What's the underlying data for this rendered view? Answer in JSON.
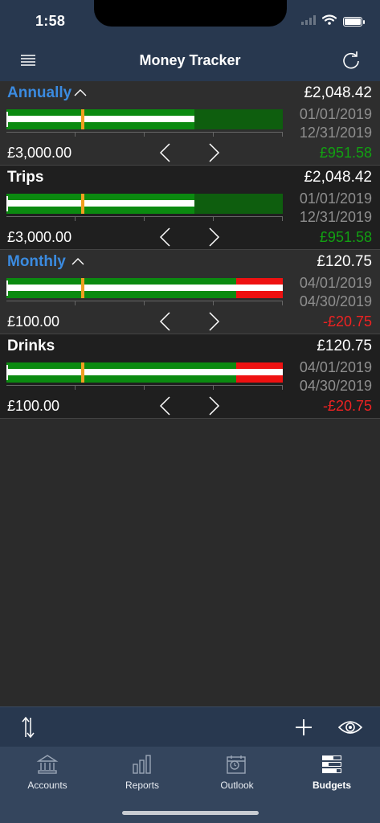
{
  "status_bar": {
    "time": "1:58"
  },
  "nav": {
    "title": "Money Tracker"
  },
  "budgets": [
    {
      "name": "Annually",
      "is_group": true,
      "spent": "£2,048.42",
      "budget": "£3,000.00",
      "start_date": "01/01/2019",
      "end_date": "12/31/2019",
      "remaining": "£951.58",
      "spent_fraction": 0.68,
      "over_fraction": 0,
      "today_fraction": 0.27
    },
    {
      "name": "Trips",
      "is_group": false,
      "spent": "£2,048.42",
      "budget": "£3,000.00",
      "start_date": "01/01/2019",
      "end_date": "12/31/2019",
      "remaining": "£951.58",
      "spent_fraction": 0.68,
      "over_fraction": 0,
      "today_fraction": 0.27
    },
    {
      "name": "Monthly",
      "is_group": true,
      "spent": "£120.75",
      "budget": "£100.00",
      "start_date": "04/01/2019",
      "end_date": "04/30/2019",
      "remaining": "-£20.75",
      "spent_fraction": 1.0,
      "over_fraction": 0.17,
      "today_fraction": 0.27
    },
    {
      "name": "Drinks",
      "is_group": false,
      "spent": "£120.75",
      "budget": "£100.00",
      "start_date": "04/01/2019",
      "end_date": "04/30/2019",
      "remaining": "-£20.75",
      "spent_fraction": 1.0,
      "over_fraction": 0.17,
      "today_fraction": 0.27
    }
  ],
  "tabs": [
    {
      "label": "Accounts",
      "icon": "bank-icon"
    },
    {
      "label": "Reports",
      "icon": "bar-chart-icon"
    },
    {
      "label": "Outlook",
      "icon": "calendar-clock-icon"
    },
    {
      "label": "Budgets",
      "icon": "budgets-icon",
      "active": true
    }
  ],
  "colors": {
    "header": "#28384f",
    "tab_bar": "#34455d",
    "group_name": "#3b8be0",
    "remaining_positive": "#12a012",
    "remaining_negative": "#ee2222",
    "bar_green": "#0b8a10",
    "bar_dark_green": "#0e5e0e",
    "bar_over": "#ee1111",
    "today_marker": "#f0a020"
  }
}
